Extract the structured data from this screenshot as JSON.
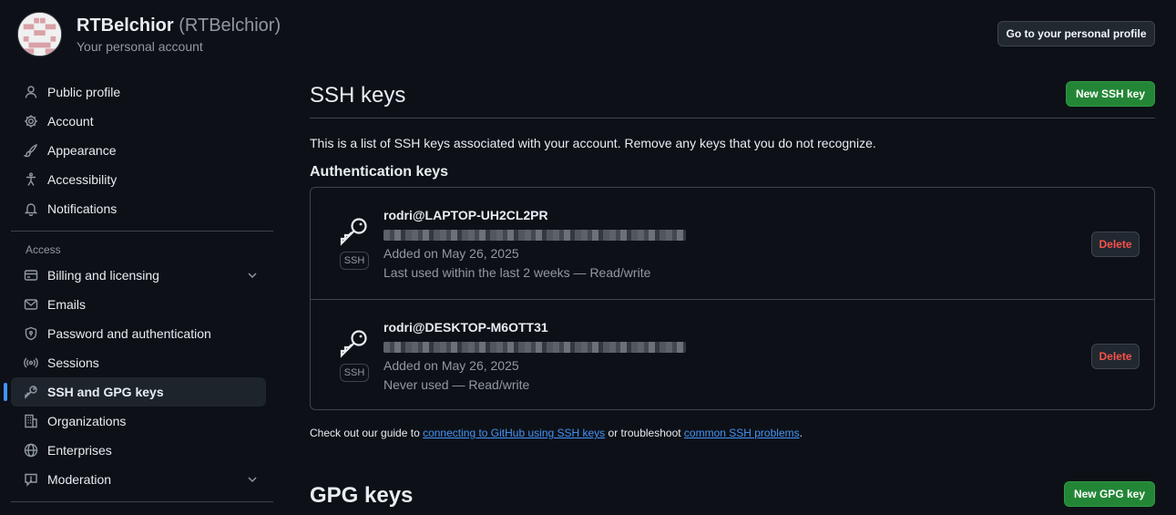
{
  "user": {
    "name": "RTBelchior",
    "login": "(RTBelchior)",
    "subtitle": "Your personal account",
    "go_profile_label": "Go to your personal profile"
  },
  "sidebar": {
    "items_top": [
      {
        "label": "Public profile",
        "icon": "person-icon"
      },
      {
        "label": "Account",
        "icon": "gear-icon"
      },
      {
        "label": "Appearance",
        "icon": "paintbrush-icon"
      },
      {
        "label": "Accessibility",
        "icon": "accessibility-icon"
      },
      {
        "label": "Notifications",
        "icon": "bell-icon"
      }
    ],
    "access_heading": "Access",
    "items_access": [
      {
        "label": "Billing and licensing",
        "icon": "credit-card-icon",
        "expandable": true
      },
      {
        "label": "Emails",
        "icon": "mail-icon"
      },
      {
        "label": "Password and authentication",
        "icon": "shield-lock-icon"
      },
      {
        "label": "Sessions",
        "icon": "broadcast-icon"
      },
      {
        "label": "SSH and GPG keys",
        "icon": "key-icon",
        "active": true
      },
      {
        "label": "Organizations",
        "icon": "organization-icon"
      },
      {
        "label": "Enterprises",
        "icon": "globe-icon"
      },
      {
        "label": "Moderation",
        "icon": "report-icon",
        "expandable": true
      }
    ]
  },
  "ssh": {
    "title": "SSH keys",
    "new_button": "New SSH key",
    "intro": "This is a list of SSH keys associated with your account. Remove any keys that you do not recognize.",
    "auth_heading": "Authentication keys",
    "badge": "SSH",
    "delete_label": "Delete",
    "keys": [
      {
        "title": "rodri@LAPTOP-UH2CL2PR",
        "added": "Added on May 26, 2025",
        "used": "Last used within the last 2 weeks — Read/write"
      },
      {
        "title": "rodri@DESKTOP-M6OTT31",
        "added": "Added on May 26, 2025",
        "used": "Never used — Read/write"
      }
    ],
    "guide_prefix": "Check out our guide to ",
    "guide_link1": "connecting to GitHub using SSH keys",
    "guide_middle": " or troubleshoot ",
    "guide_link2": "common SSH problems",
    "guide_suffix": "."
  },
  "gpg": {
    "title": "GPG keys",
    "new_button": "New GPG key"
  },
  "colors": {
    "background": "#0d1117",
    "primary_button": "#238636",
    "danger_text": "#f85149",
    "link": "#4493f8",
    "active_indicator": "#4493f8"
  }
}
